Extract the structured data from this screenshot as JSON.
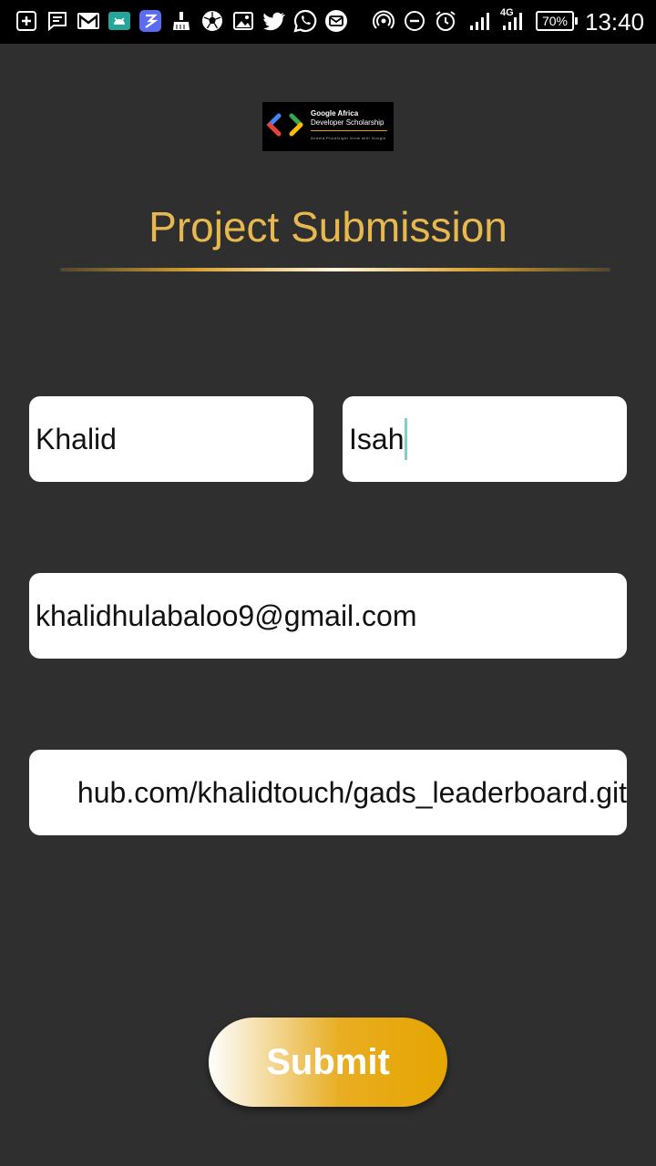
{
  "status_bar": {
    "battery": "70%",
    "network": "4G",
    "time": "13:40",
    "icons": [
      "add-box-icon",
      "message-icon",
      "gmail-icon",
      "android-icon",
      "app-icon",
      "cleaner-icon",
      "soccer-ball-icon",
      "image-icon",
      "twitter-icon",
      "whatsapp-icon",
      "mail-icon",
      "hotspot-icon",
      "do-not-disturb-icon",
      "alarm-icon",
      "signal-icon",
      "signal-4g-icon"
    ]
  },
  "logo": {
    "line1": "Google Africa",
    "line2": "Developer Scholarship",
    "line3": "Andela  Pluralsight  Grow with Google"
  },
  "page": {
    "title": "Project Submission"
  },
  "form": {
    "first_name": "Khalid",
    "last_name": "Isah",
    "email": "khalidhulabaloo9@gmail.com",
    "project_link": "hub.com/khalidtouch/gads_leaderboard.git"
  },
  "actions": {
    "submit_label": "Submit"
  },
  "colors": {
    "background": "#2f2f2f",
    "title": "#e6b84f",
    "accent": "#e6a500",
    "cursor": "#7fd0c8"
  }
}
